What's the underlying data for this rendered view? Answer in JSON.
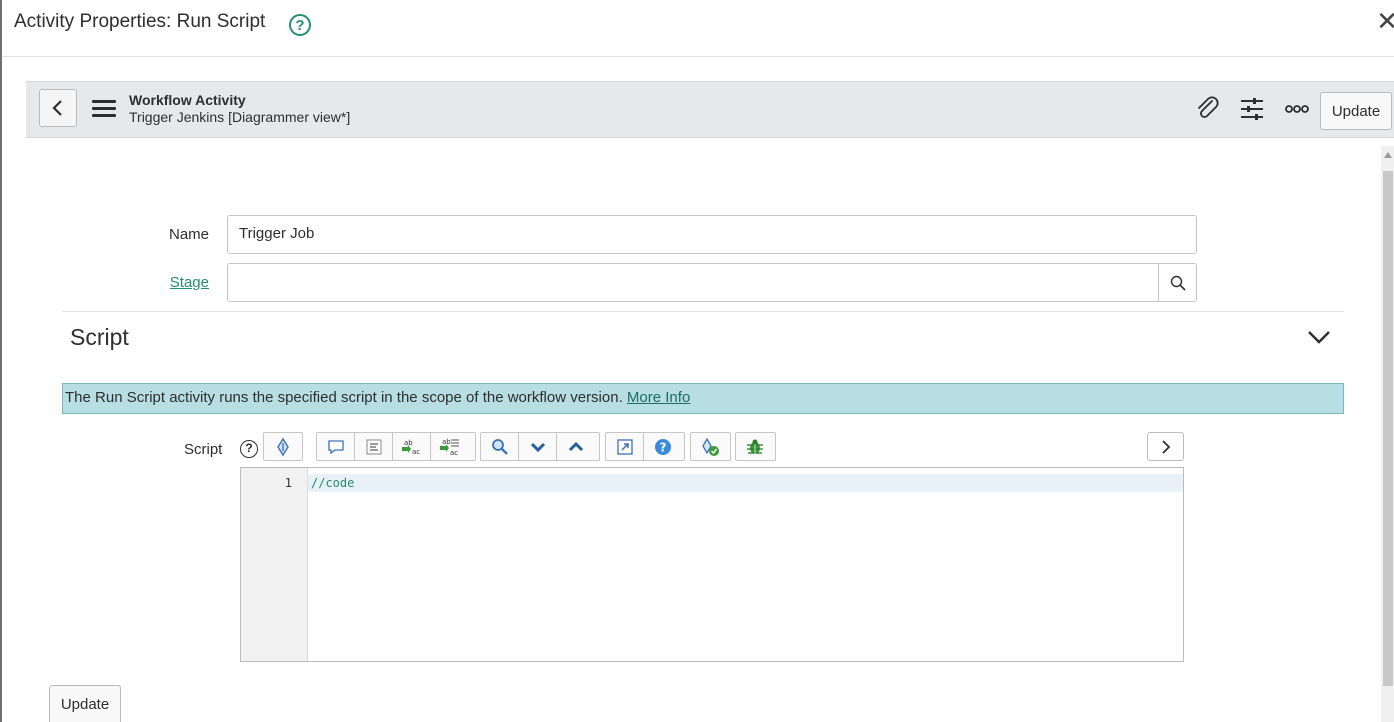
{
  "dialog": {
    "title": "Activity Properties: Run Script",
    "help_glyph": "?",
    "close_glyph": "✕"
  },
  "form_header": {
    "record_type": "Workflow Activity",
    "record_name": "Trigger Jenkins [Diagrammer view*]",
    "update_label": "Update",
    "icons": [
      "attachment-icon",
      "settings-sliders-icon",
      "more-options-icon"
    ]
  },
  "fields": {
    "name_label": "Name",
    "name_value": "Trigger Job",
    "stage_label": "Stage",
    "stage_value": ""
  },
  "script_section": {
    "title": "Script",
    "info_text": "The Run Script activity runs the specified script in the scope of the workflow version.",
    "info_link": "More Info",
    "script_label": "Script",
    "help_glyph": "?",
    "toolbar_icons": [
      "toggle-syntax-icon",
      "comment-icon",
      "format-code-icon",
      "replace-icon",
      "replace-all-icon",
      "search-icon",
      "find-next-icon",
      "find-previous-icon",
      "fullscreen-icon",
      "help-icon",
      "script-validate-icon",
      "debug-icon"
    ],
    "line_number": "1",
    "code": "//code"
  },
  "footer": {
    "update_label": "Update"
  },
  "colors": {
    "accent": "#278d6e",
    "info_bg": "#b7dee3",
    "header_bg": "#e6e8ea"
  }
}
